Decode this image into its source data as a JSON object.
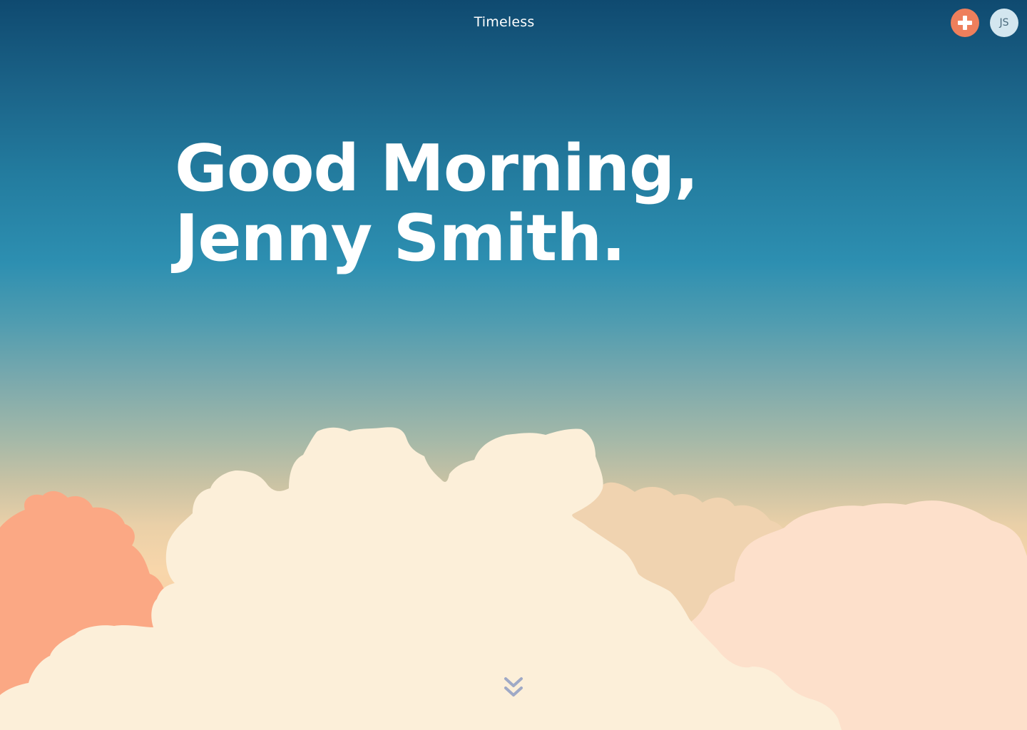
{
  "header": {
    "app_title": "Timeless",
    "add_icon": "plus-icon",
    "avatar_initials": "JS"
  },
  "greeting": {
    "line1": "Good Morning,",
    "line2": "Jenny Smith."
  },
  "scroll": {
    "icon": "chevron-double-down-icon"
  },
  "colors": {
    "accent": "#ee7f5c",
    "avatar_bg": "#d3e6ef",
    "sky_top": "#0f4a70",
    "sky_mid": "#2d8fb1",
    "sky_bottom": "#f8d6aa",
    "cloud_cream": "#fcefd9",
    "cloud_peach": "#fde0cb",
    "cloud_orange": "#fba884",
    "cloud_tan": "#f0d3b0"
  }
}
